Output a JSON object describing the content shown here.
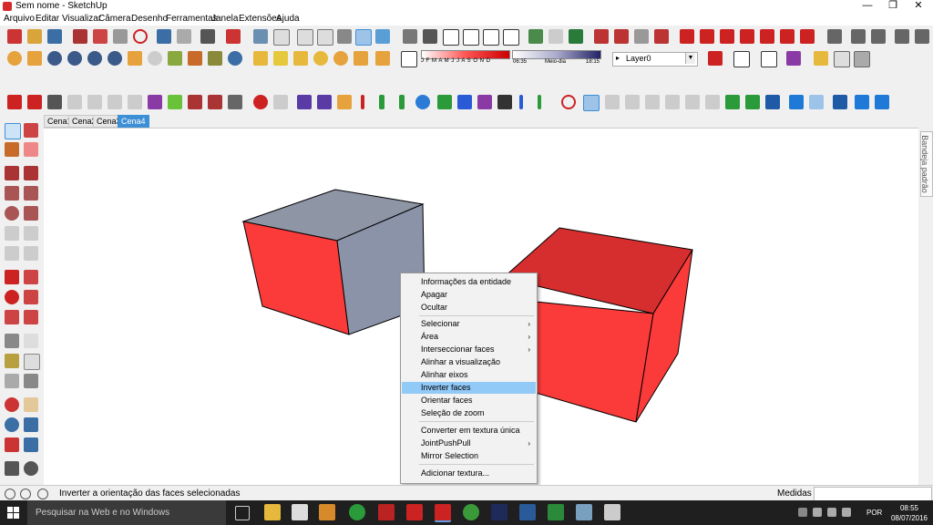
{
  "window": {
    "title": "Sem nome - SketchUp",
    "minimize": "—",
    "restore": "❐",
    "close": "✕"
  },
  "menu": [
    "Arquivo",
    "Editar",
    "Visualizar",
    "Câmera",
    "Desenho",
    "Ferramentas",
    "Janela",
    "Extensões",
    "Ajuda"
  ],
  "toolbar": {
    "months": "J F M A M J J A S O N D",
    "time_start": "06:35",
    "time_mid": "Meio-dia",
    "time_end": "18:15",
    "layer": "Layer0"
  },
  "scenes": [
    "Cena1",
    "Cena2",
    "Cena3",
    "Cena4"
  ],
  "right_panel": {
    "tab": "Bandeja padrão"
  },
  "context_menu": {
    "items": [
      {
        "label": "Informações da entidade"
      },
      {
        "label": "Apagar"
      },
      {
        "label": "Ocultar"
      },
      {
        "label": "Selecionar",
        "submenu": true
      },
      {
        "label": "Área",
        "submenu": true
      },
      {
        "label": "Interseccionar faces",
        "submenu": true
      },
      {
        "label": "Alinhar a visualização"
      },
      {
        "label": "Alinhar eixos"
      },
      {
        "label": "Inverter faces",
        "highlighted": true
      },
      {
        "label": "Orientar faces"
      },
      {
        "label": "Seleção de zoom"
      },
      {
        "label": "Converter em textura única"
      },
      {
        "label": "JointPushPull",
        "submenu": true
      },
      {
        "label": "Mirror Selection"
      },
      {
        "label": "Adicionar textura..."
      }
    ],
    "submenu_arrow": "›"
  },
  "status": {
    "text": "Inverter a orientação das faces selecionadas",
    "measures_label": "Medidas"
  },
  "taskbar": {
    "search_placeholder": "Pesquisar na Web e no Windows",
    "lang": "POR",
    "time": "08:55",
    "date": "08/07/2016"
  },
  "colors": {
    "face_red": "#fb3a3a",
    "face_dark_red": "#d62e2e",
    "face_selected": "#8a93a8",
    "accent": "#3d8fd6",
    "highlight": "#91c9f7"
  }
}
